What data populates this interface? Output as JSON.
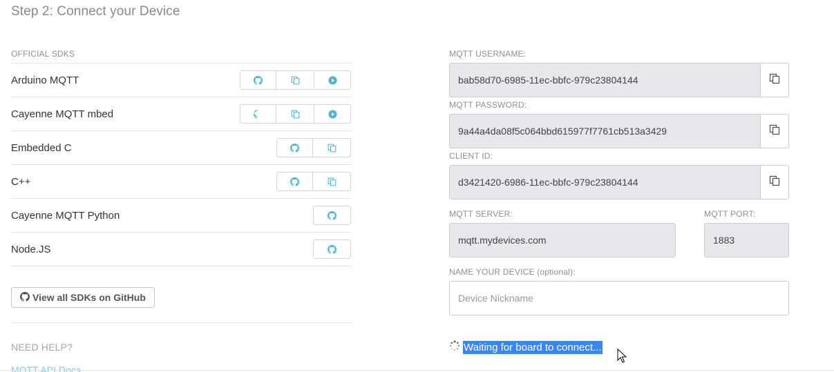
{
  "step_title": "Step 2: Connect your Device",
  "sdks": {
    "heading": "OFFICIAL SDKS",
    "items": [
      {
        "name": "Arduino MQTT",
        "buttons": [
          "github-icon",
          "copy-icon",
          "play-icon"
        ]
      },
      {
        "name": "Cayenne MQTT mbed",
        "buttons": [
          "github-icon",
          "copy-icon",
          "play-icon"
        ]
      },
      {
        "name": "Embedded C",
        "buttons": [
          "github-icon",
          "copy-icon"
        ]
      },
      {
        "name": "C++",
        "buttons": [
          "github-icon",
          "copy-icon"
        ]
      },
      {
        "name": "Cayenne MQTT Python",
        "buttons": [
          "github-icon"
        ]
      },
      {
        "name": "Node.JS",
        "buttons": [
          "github-icon"
        ]
      }
    ],
    "view_all_label": "View all SDKs on GitHub"
  },
  "help": {
    "heading": "NEED HELP?",
    "docs_link": "MQTT API Docs"
  },
  "credentials": {
    "username_label": "MQTT USERNAME:",
    "username": "bab58d70-6985-11ec-bbfc-979c23804144",
    "password_label": "MQTT PASSWORD:",
    "password": "9a44a4da08f5c064bbd615977f7761cb513a3429",
    "client_id_label": "CLIENT ID:",
    "client_id": "d3421420-6986-11ec-bbfc-979c23804144",
    "server_label": "MQTT SERVER:",
    "server": "mqtt.mydevices.com",
    "port_label": "MQTT PORT:",
    "port": "1883"
  },
  "device_name": {
    "label": "NAME YOUR DEVICE (optional):",
    "placeholder": "Device Nickname",
    "value": ""
  },
  "status": {
    "text": "Waiting for board to connect..."
  },
  "colors": {
    "accent": "#4fb6d2",
    "selection": "#3a86ec",
    "field_bg": "#e6e8ec"
  }
}
